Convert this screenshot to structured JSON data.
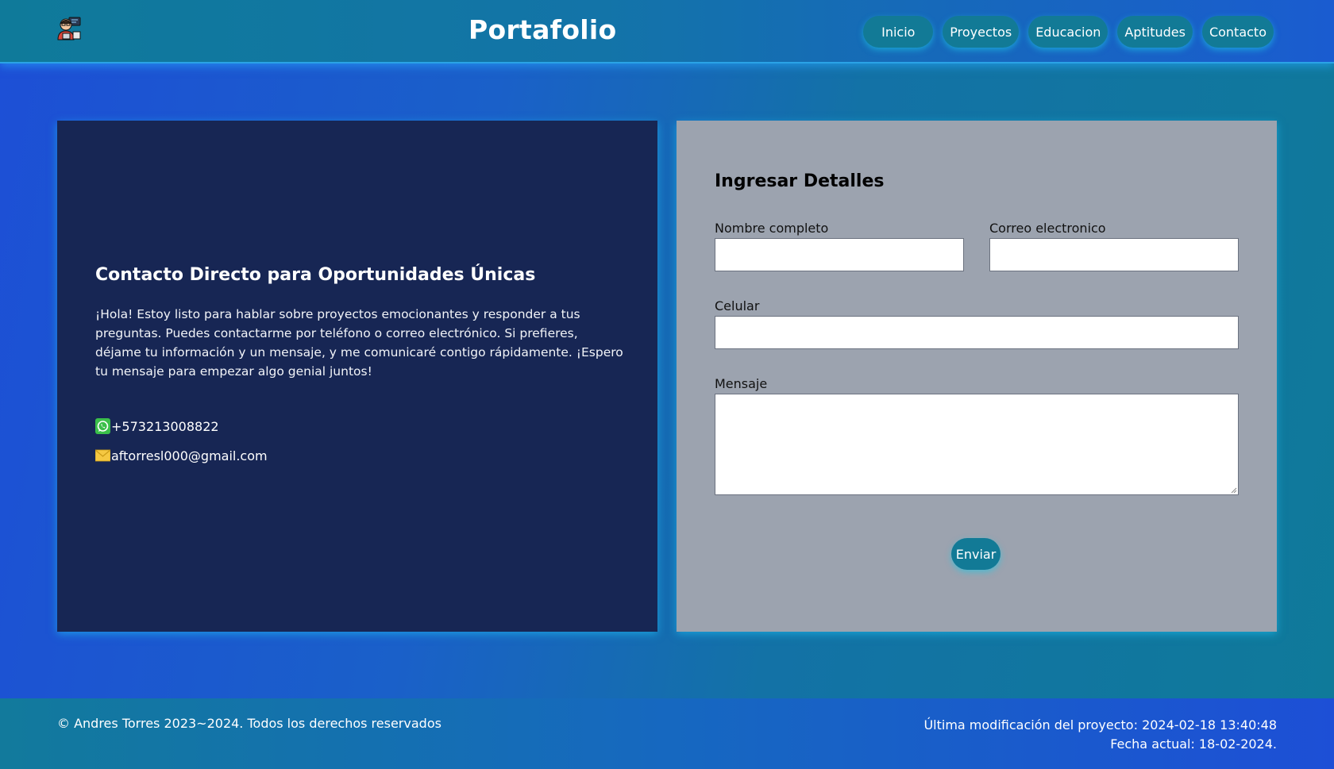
{
  "header": {
    "brand": "Portafolio",
    "nav": [
      "Inicio",
      "Proyectos",
      "Educacion",
      "Aptitudes",
      "Contacto"
    ]
  },
  "contact": {
    "title": "Contacto Directo para Oportunidades Únicas",
    "text": "¡Hola! Estoy listo para hablar sobre proyectos emocionantes y responder a tus preguntas. Puedes contactarme por teléfono o correo electrónico. Si prefieres, déjame tu información y un mensaje, y me comunicaré contigo rápidamente. ¡Espero tu mensaje para empezar algo genial juntos!",
    "phone": "+573213008822",
    "email": "aftorresl000@gmail.com"
  },
  "form": {
    "title": "Ingresar Detalles",
    "name_label": "Nombre completo",
    "email_label": "Correo electronico",
    "phone_label": "Celular",
    "message_label": "Mensaje",
    "submit": "Enviar"
  },
  "footer": {
    "copyright": "© Andres Torres 2023~2024. Todos los derechos reservados",
    "last_modified": "Última modificación del proyecto: 2024-02-18 13:40:48",
    "current_date": "Fecha actual: 18-02-2024."
  },
  "icons": {
    "logo": "developer-avatar-icon",
    "phone": "whatsapp-icon",
    "email": "envelope-icon"
  },
  "colors": {
    "button": "#127a96",
    "panel_dark": "#172654",
    "panel_light": "#9ca3af"
  }
}
